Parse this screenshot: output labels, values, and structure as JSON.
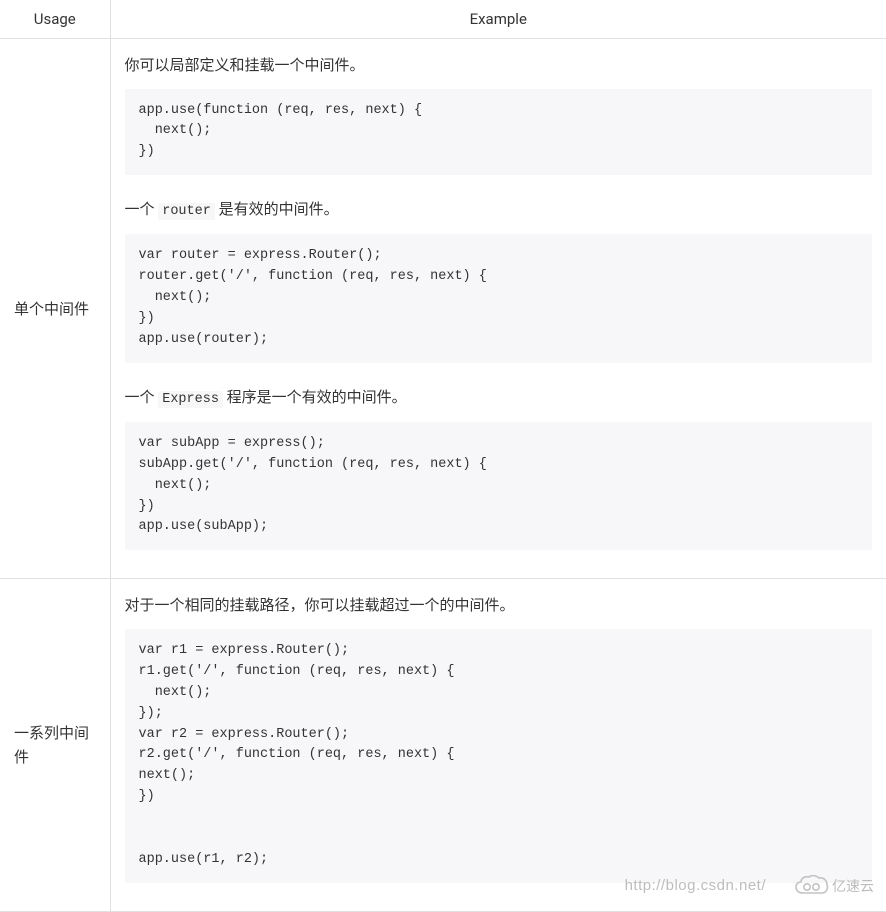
{
  "headers": {
    "usage": "Usage",
    "example": "Example"
  },
  "rows": [
    {
      "usage": "单个中间件",
      "sections": [
        {
          "desc_pre": "你可以局部定义和挂载一个中间件。",
          "inline_code": "",
          "desc_post": "",
          "code": "app.use(function (req, res, next) {\n  next();\n})"
        },
        {
          "desc_pre": "一个 ",
          "inline_code": "router",
          "desc_post": " 是有效的中间件。",
          "code": "var router = express.Router();\nrouter.get('/', function (req, res, next) {\n  next();\n})\napp.use(router);"
        },
        {
          "desc_pre": "一个 ",
          "inline_code": "Express",
          "desc_post": " 程序是一个有效的中间件。",
          "code": "var subApp = express();\nsubApp.get('/', function (req, res, next) {\n  next();\n})\napp.use(subApp);"
        }
      ]
    },
    {
      "usage": "一系列中间件",
      "sections": [
        {
          "desc_pre": "对于一个相同的挂载路径，你可以挂载超过一个的中间件。",
          "inline_code": "",
          "desc_post": "",
          "code": "var r1 = express.Router();\nr1.get('/', function (req, res, next) {\n  next();\n});\nvar r2 = express.Router();\nr2.get('/', function (req, res, next) {\nnext();\n})\n\n\napp.use(r1, r2);"
        }
      ]
    }
  ],
  "watermark": {
    "url": "http://blog.csdn.net/",
    "logo_text": "亿速云"
  }
}
